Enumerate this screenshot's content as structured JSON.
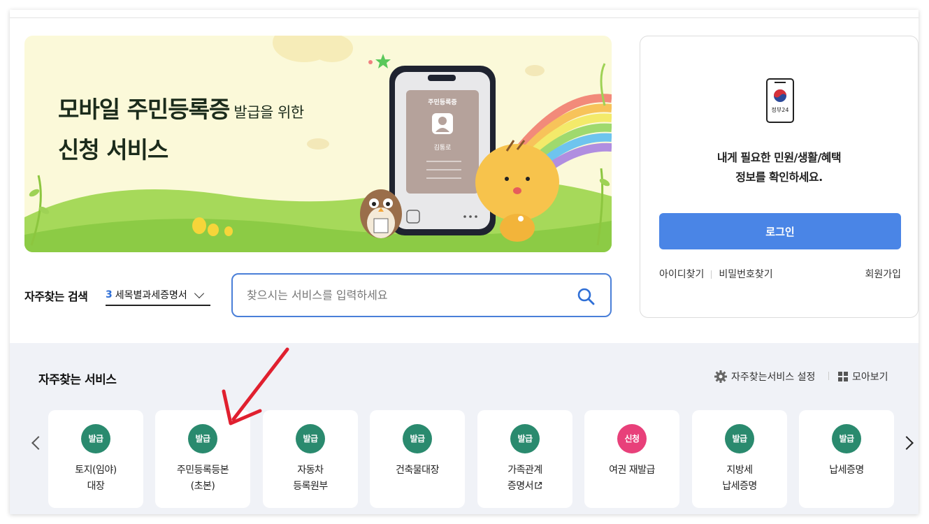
{
  "banner": {
    "title_line1_big": "모바일 주민등록증",
    "title_line1_small": "발급을 위한",
    "title_line2": "신청 서비스",
    "phone_card_title": "주민등록증",
    "phone_card_name": "김통로"
  },
  "search": {
    "fav_label": "자주찾는 검색",
    "fav_rank": "3",
    "fav_term": "세목별과세증명서",
    "placeholder": "찾으시는 서비스를 입력하세요"
  },
  "login": {
    "app_logo_text": "정부24",
    "message_line1": "내게 필요한 민원/생활/혜택",
    "message_line2": "정보를 확인하세요.",
    "login_button": "로그인",
    "find_id": "아이디찾기",
    "find_password": "비밀번호찾기",
    "signup": "회원가입"
  },
  "services": {
    "title": "자주찾는 서비스",
    "settings_label": "자주찾는서비스 설정",
    "view_all_label": "모아보기",
    "items": [
      {
        "badge": "발급",
        "label": "토지(임야)\n대장"
      },
      {
        "badge": "발급",
        "label": "주민등록등본\n(초본)"
      },
      {
        "badge": "발급",
        "label": "자동차\n등록원부"
      },
      {
        "badge": "발급",
        "label": "건축물대장"
      },
      {
        "badge": "발급",
        "label": "가족관계\n증명서"
      },
      {
        "badge": "신청",
        "label": "여권 재발급"
      },
      {
        "badge": "발급",
        "label": "지방세\n납세증명"
      },
      {
        "badge": "발급",
        "label": "납세증명"
      }
    ]
  },
  "colors": {
    "accent_blue": "#4a85e6",
    "badge_issue": "#2a8a6e",
    "badge_apply": "#e8407a",
    "annotation_arrow": "#e0202f"
  }
}
